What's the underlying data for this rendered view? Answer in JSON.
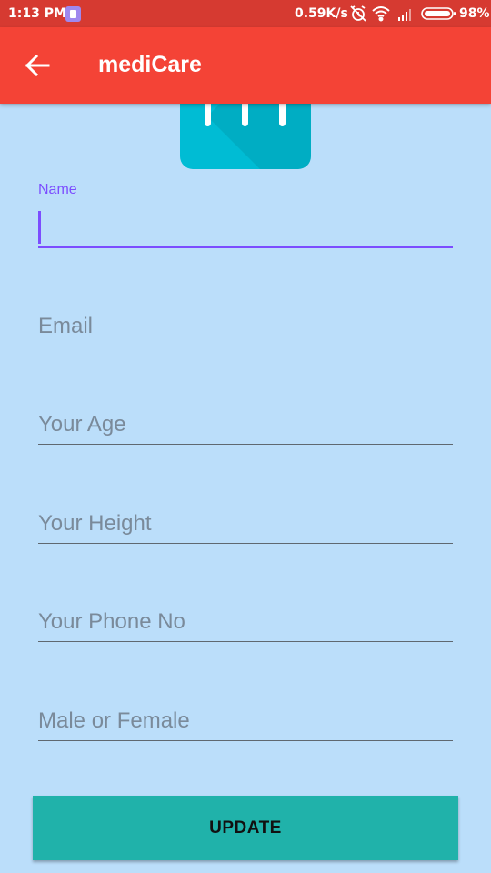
{
  "status_bar": {
    "time": "1:13 PM",
    "net_speed": "0.59K/s",
    "battery": "98%",
    "icons": [
      "app-notification-icon",
      "alarm-off-icon",
      "wifi-icon",
      "signal-icon",
      "battery-icon"
    ]
  },
  "app_bar": {
    "title": "mediCare",
    "back_icon": "arrow-left-icon"
  },
  "colors": {
    "status_bar": "#d63a31",
    "app_bar": "#f44336",
    "background": "#bbdefa",
    "accent": "#7c4dff",
    "logo": "#00bcd4",
    "button": "#20b2aa"
  },
  "form": {
    "name": {
      "label": "Name",
      "value": "",
      "focused": true
    },
    "email": {
      "placeholder": "Email"
    },
    "age": {
      "placeholder": "Your Age"
    },
    "height": {
      "placeholder": "Your Height"
    },
    "phone": {
      "placeholder": "Your Phone No"
    },
    "gender": {
      "placeholder": "Male or Female"
    },
    "update_label": "UPDATE"
  }
}
